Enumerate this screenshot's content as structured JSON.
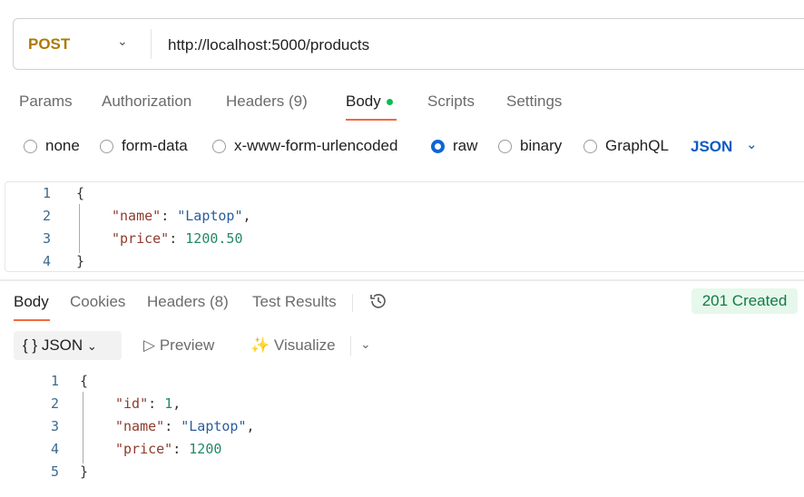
{
  "request": {
    "method": "POST",
    "url": "http://localhost:5000/products",
    "tabs": [
      {
        "label": "Params"
      },
      {
        "label": "Authorization"
      },
      {
        "label": "Headers",
        "count": "(9)"
      },
      {
        "label": "Body"
      },
      {
        "label": "Scripts"
      },
      {
        "label": "Settings"
      }
    ],
    "body_types": [
      "none",
      "form-data",
      "x-www-form-urlencoded",
      "raw",
      "binary",
      "GraphQL"
    ],
    "selected_body_type": "raw",
    "format": "JSON",
    "line_numbers": [
      "1",
      "2",
      "3",
      "4"
    ],
    "code": [
      [
        {
          "t": "{",
          "c": "p"
        }
      ],
      [
        {
          "t": "\"name\"",
          "c": "k"
        },
        {
          "t": ": ",
          "c": "p"
        },
        {
          "t": "\"Laptop\"",
          "c": "s"
        },
        {
          "t": ",",
          "c": "p"
        }
      ],
      [
        {
          "t": "\"price\"",
          "c": "k"
        },
        {
          "t": ": ",
          "c": "p"
        },
        {
          "t": "1200.50",
          "c": "n"
        }
      ],
      [
        {
          "t": "}",
          "c": "p"
        }
      ]
    ]
  },
  "response": {
    "tabs": [
      {
        "label": "Body"
      },
      {
        "label": "Cookies"
      },
      {
        "label": "Headers",
        "count": "(8)"
      },
      {
        "label": "Test Results"
      }
    ],
    "status": "201 Created",
    "format_label": "JSON",
    "format_icon": "{ }",
    "preview_label": "Preview",
    "visualize_label": "Visualize",
    "line_numbers": [
      "1",
      "2",
      "3",
      "4",
      "5"
    ],
    "code": [
      [
        {
          "t": "{",
          "c": "p"
        }
      ],
      [
        {
          "t": "\"id\"",
          "c": "k"
        },
        {
          "t": ": ",
          "c": "p"
        },
        {
          "t": "1",
          "c": "n"
        },
        {
          "t": ",",
          "c": "p"
        }
      ],
      [
        {
          "t": "\"name\"",
          "c": "k"
        },
        {
          "t": ": ",
          "c": "p"
        },
        {
          "t": "\"Laptop\"",
          "c": "s"
        },
        {
          "t": ",",
          "c": "p"
        }
      ],
      [
        {
          "t": "\"price\"",
          "c": "k"
        },
        {
          "t": ": ",
          "c": "p"
        },
        {
          "t": "1200",
          "c": "n"
        }
      ],
      [
        {
          "t": "}",
          "c": "p"
        }
      ]
    ]
  }
}
